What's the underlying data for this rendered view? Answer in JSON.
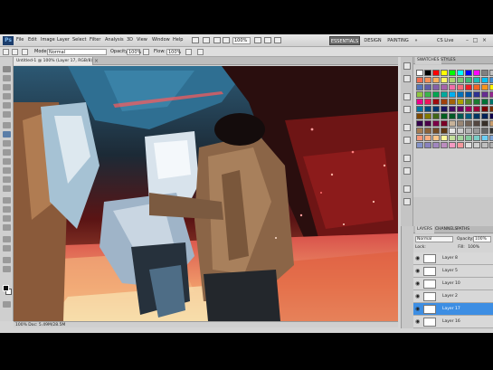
{
  "app_bar": {
    "logo": "Ps",
    "menus": [
      "File",
      "Edit",
      "Image",
      "Layer",
      "Select",
      "Filter",
      "Analysis",
      "3D",
      "View",
      "Window",
      "Help"
    ],
    "zoom": "100%",
    "workspaces": [
      "ESSENTIALS",
      "DESIGN",
      "PAINTING"
    ],
    "more_label": "»",
    "cs_live": "CS Live",
    "window_buttons": [
      "–",
      "□",
      "×"
    ]
  },
  "options_bar": {
    "mode_label": "Mode:",
    "mode_value": "Normal",
    "opacity_label": "Opacity:",
    "opacity_value": "100%",
    "flow_label": "Flow:",
    "flow_value": "100%"
  },
  "document": {
    "tab_title": "Untitled-1 @ 100% (Layer 17, RGB/8)",
    "close_glyph": "×"
  },
  "status_bar": {
    "text": "100%  Doc: 5.49M/28.5M"
  },
  "swatches_panel": {
    "tabs": [
      "SWATCHES",
      "STYLES"
    ],
    "colors": [
      "#ffffff",
      "#000000",
      "#ff0000",
      "#ffff00",
      "#00ff00",
      "#00ffff",
      "#0000ff",
      "#ff00ff",
      "#808080",
      "#c0c0c0",
      "#f26c4f",
      "#f68e56",
      "#fbaf5d",
      "#fff467",
      "#acd372",
      "#7cc576",
      "#3bb878",
      "#1abbb4",
      "#00bff3",
      "#438ccb",
      "#5574b9",
      "#605ca8",
      "#855fa8",
      "#a763a9",
      "#f06ea9",
      "#f26d7d",
      "#ed1c24",
      "#f26522",
      "#f7941d",
      "#fff200",
      "#8dc63f",
      "#39b54a",
      "#00a651",
      "#00a99d",
      "#00aeef",
      "#0072bc",
      "#0054a6",
      "#2e3192",
      "#662d91",
      "#92278f",
      "#ec008c",
      "#ed145b",
      "#9e0b0f",
      "#a0410d",
      "#a3620a",
      "#aba000",
      "#598527",
      "#1a7b30",
      "#007236",
      "#00746b",
      "#0076a3",
      "#004a80",
      "#003471",
      "#1b1464",
      "#440e62",
      "#630460",
      "#9e005d",
      "#9e0039",
      "#790000",
      "#7b2e00",
      "#7d4900",
      "#827b00",
      "#406618",
      "#005e20",
      "#005826",
      "#005952",
      "#005b7f",
      "#003663",
      "#002157",
      "#0d004c",
      "#32004b",
      "#4b0049",
      "#7b0046",
      "#7a0026",
      "#c7b299",
      "#998675",
      "#736357",
      "#534741",
      "#37302a",
      "#c69c6d",
      "#a67c52",
      "#8c6239",
      "#754c24",
      "#603913",
      "#e6e6e6",
      "#cccccc",
      "#b3b3b3",
      "#999999",
      "#666666",
      "#333333",
      "#f7977a",
      "#f9ad81",
      "#fdc68a",
      "#fff79a",
      "#c4df9b",
      "#a3d39c",
      "#82ca9d",
      "#7bcdc8",
      "#6ecff6",
      "#7ea7d8",
      "#8493ca",
      "#8882be",
      "#a187be",
      "#bc8dbf",
      "#f49ac2",
      "#f6989d",
      "#e0e0e0",
      "#cfcfcf",
      "#bfbfbf",
      "#afafaf"
    ]
  },
  "layers_panel": {
    "tabs": [
      "LAYERS",
      "CHANNELS",
      "PATHS"
    ],
    "blend_mode": "Normal",
    "opacity_label": "Opacity:",
    "opacity_value": "100%",
    "lock_label": "Lock:",
    "fill_label": "Fill:",
    "fill_value": "100%",
    "layers": [
      {
        "name": "Layer 8",
        "selected": false
      },
      {
        "name": "Layer 5",
        "selected": false
      },
      {
        "name": "Layer 10",
        "selected": false
      },
      {
        "name": "Layer 2",
        "selected": false
      },
      {
        "name": "Layer 17",
        "selected": true
      },
      {
        "name": "Layer 16",
        "selected": false
      }
    ]
  },
  "colors": {
    "accent": "#3d8ee3",
    "chrome": "#d4d4d4"
  }
}
